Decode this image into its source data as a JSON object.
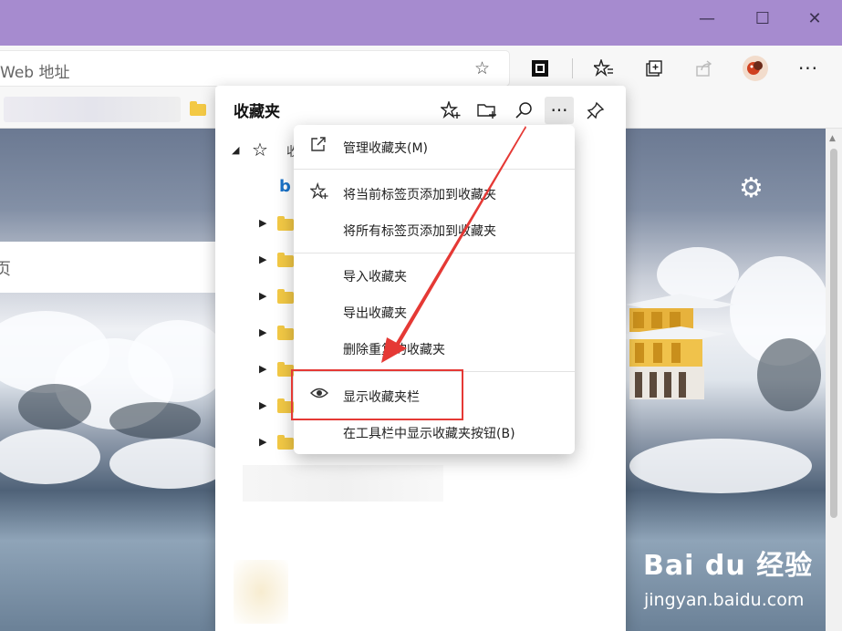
{
  "window": {
    "controls": {
      "minimize": "—",
      "maximize": "☐",
      "close": "✕"
    }
  },
  "address_bar": {
    "placeholder": "Web 地址",
    "icons": [
      "favorite-star-icon",
      "app-icon",
      "favorites-icon",
      "collections-icon",
      "share-icon",
      "profile-avatar",
      "more-icon"
    ]
  },
  "favorites_panel": {
    "title": "收藏夹",
    "root_label": "收",
    "header_icons": [
      "add-favorite-icon",
      "add-folder-icon",
      "search-icon",
      "more-options-icon",
      "pin-icon"
    ],
    "folder_count": 7
  },
  "context_menu": {
    "items": [
      {
        "label": "管理收藏夹(M)",
        "icon": "external-link-icon"
      },
      {
        "label": "将当前标签页添加到收藏夹",
        "icon": "add-favorite-icon"
      },
      {
        "label": "将所有标签页添加到收藏夹",
        "icon": ""
      },
      {
        "label": "导入收藏夹",
        "icon": ""
      },
      {
        "label": "导出收藏夹",
        "icon": ""
      },
      {
        "label": "删除重复的收藏夹",
        "icon": ""
      },
      {
        "label": "显示收藏夹栏",
        "icon": "eye-icon"
      },
      {
        "label": "在工具栏中显示收藏夹按钮(B)",
        "icon": ""
      }
    ],
    "highlighted_item": "显示收藏夹栏"
  },
  "page": {
    "search_hint": "页"
  },
  "watermark": {
    "logo_text": "Bai du 经验",
    "url": "jingyan.baidu.com"
  },
  "colors": {
    "titlebar": "#a68bcf",
    "annotation_red": "#e53935"
  }
}
